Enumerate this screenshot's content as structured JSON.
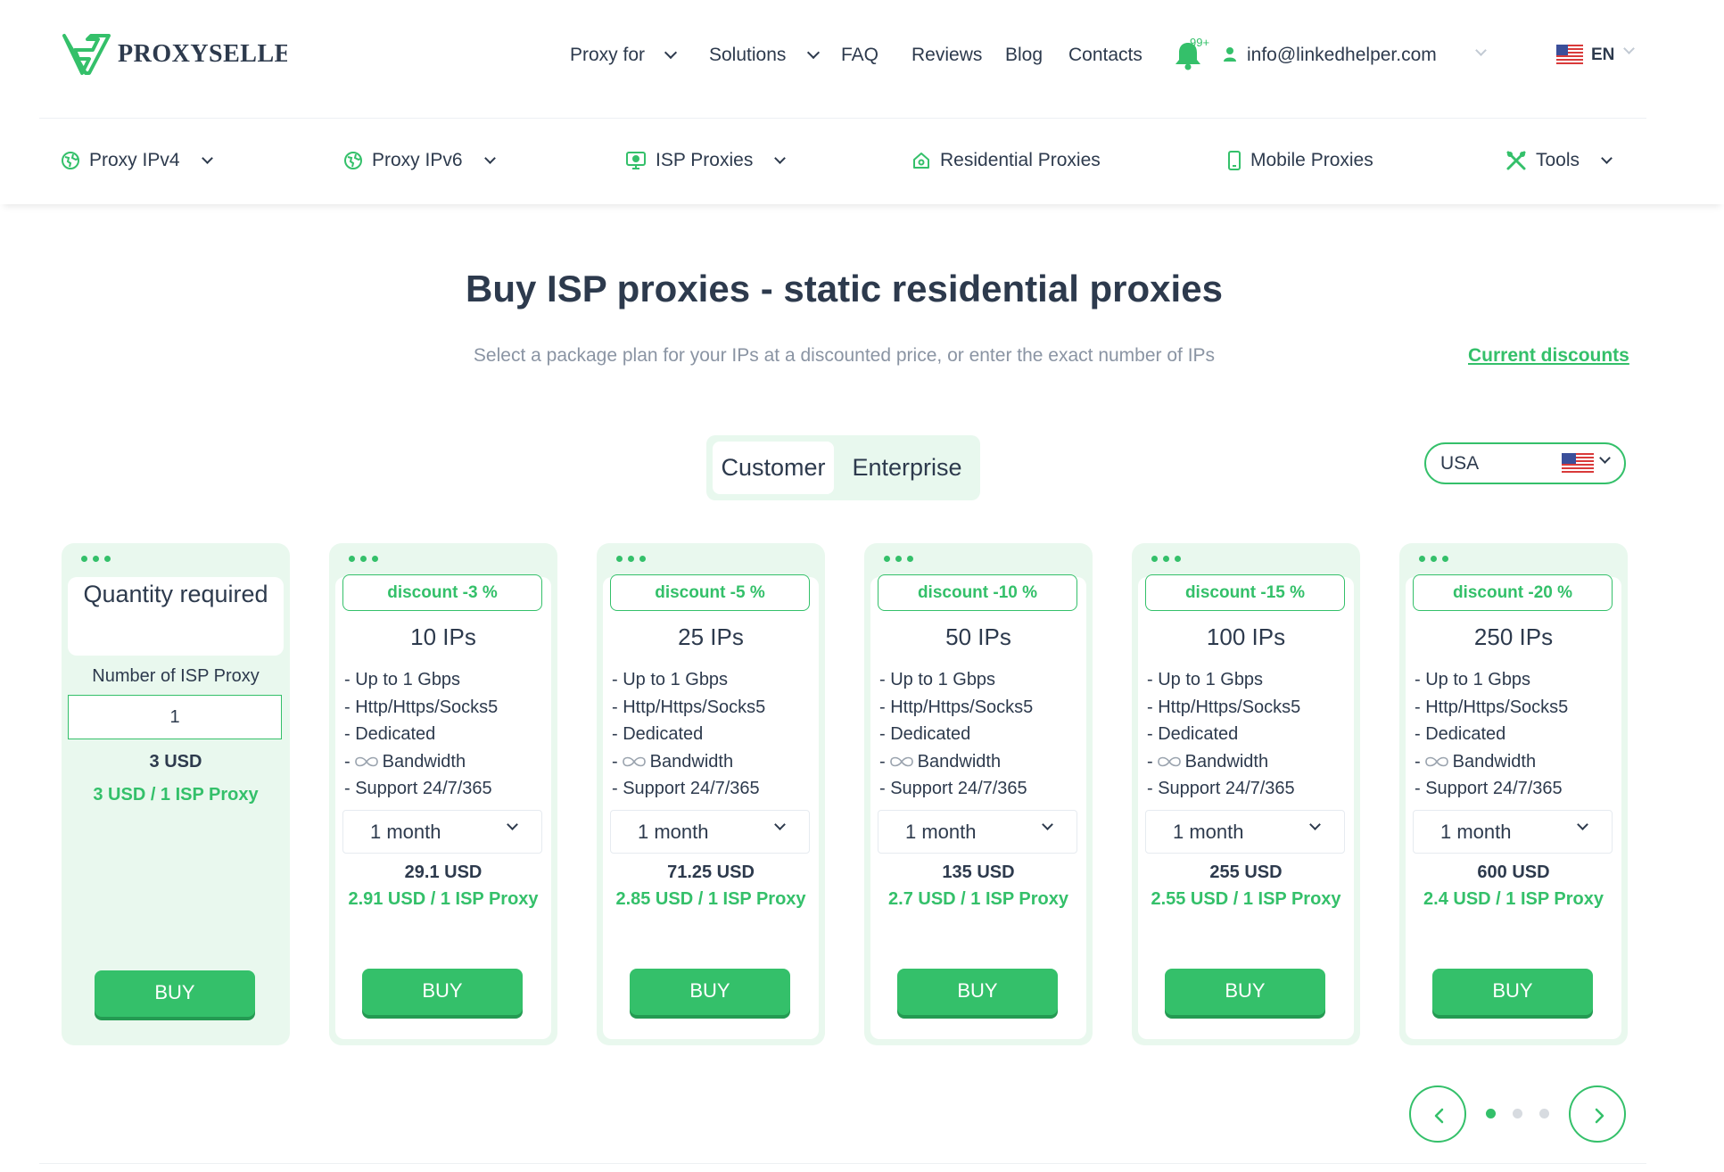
{
  "brand": {
    "logo_text": "PROXYSELLER"
  },
  "top_nav": {
    "items": [
      {
        "label": "Proxy for",
        "dropdown": true
      },
      {
        "label": "Solutions",
        "dropdown": true
      },
      {
        "label": "FAQ"
      },
      {
        "label": "Reviews"
      },
      {
        "label": "Blog"
      },
      {
        "label": "Contacts"
      }
    ],
    "notifications_badge": "99+",
    "email": "info@linkedhelper.com",
    "language": "EN"
  },
  "categories": [
    {
      "label": "Proxy IPv4",
      "icon": "globe-icon",
      "dropdown": true
    },
    {
      "label": "Proxy IPv6",
      "icon": "globe-icon",
      "dropdown": true
    },
    {
      "label": "ISP Proxies",
      "icon": "monitor-globe-icon",
      "dropdown": true
    },
    {
      "label": "Residential Proxies",
      "icon": "home-icon",
      "dropdown": false
    },
    {
      "label": "Mobile Proxies",
      "icon": "phone-icon",
      "dropdown": false
    },
    {
      "label": "Tools",
      "icon": "tools-icon",
      "dropdown": true
    }
  ],
  "hero": {
    "title": "Buy ISP proxies - static residential proxies",
    "subtitle": "Select a package plan for your IPs at a discounted price, or enter the exact number of IPs",
    "discounts_link": "Current discounts"
  },
  "toggle": {
    "options": [
      "Customer",
      "Enterprise"
    ],
    "selected": "Customer"
  },
  "country": {
    "value": "USA",
    "icon": "us-flag-icon"
  },
  "custom_card": {
    "title": "Quantity required",
    "input_label": "Number of ISP Proxy",
    "input_value": "1",
    "price": "3 USD",
    "unit_price": "3 USD / 1 ISP Proxy",
    "buy_label": "BUY"
  },
  "plans": [
    {
      "discount": "discount -3 %",
      "ips": "10 IPs",
      "period": "1 month",
      "total": "29.1 USD",
      "unit_price": "2.91 USD / 1 ISP Proxy"
    },
    {
      "discount": "discount -5 %",
      "ips": "25 IPs",
      "period": "1 month",
      "total": "71.25 USD",
      "unit_price": "2.85 USD / 1 ISP Proxy"
    },
    {
      "discount": "discount -10 %",
      "ips": "50 IPs",
      "period": "1 month",
      "total": "135 USD",
      "unit_price": "2.7 USD / 1 ISP Proxy"
    },
    {
      "discount": "discount -15 %",
      "ips": "100 IPs",
      "period": "1 month",
      "total": "255 USD",
      "unit_price": "2.55 USD / 1 ISP Proxy"
    },
    {
      "discount": "discount -20 %",
      "ips": "250 IPs",
      "period": "1 month",
      "total": "600 USD",
      "unit_price": "2.4 USD / 1 ISP Proxy"
    }
  ],
  "plan_features": {
    "speed": "- Up to 1 Gbps",
    "protocols": "- Http/Https/Socks5",
    "type": "- Dedicated",
    "bandwidth_prefix": "-",
    "bandwidth": "Bandwidth",
    "support": "- Support 24/7/365"
  },
  "buy_label": "BUY",
  "pager": {
    "pages": 3,
    "current": 1
  },
  "colors": {
    "accent": "#34c06a",
    "text": "#2d3a4d",
    "muted": "#8a94a3",
    "card_bg": "#e9f8ee"
  }
}
